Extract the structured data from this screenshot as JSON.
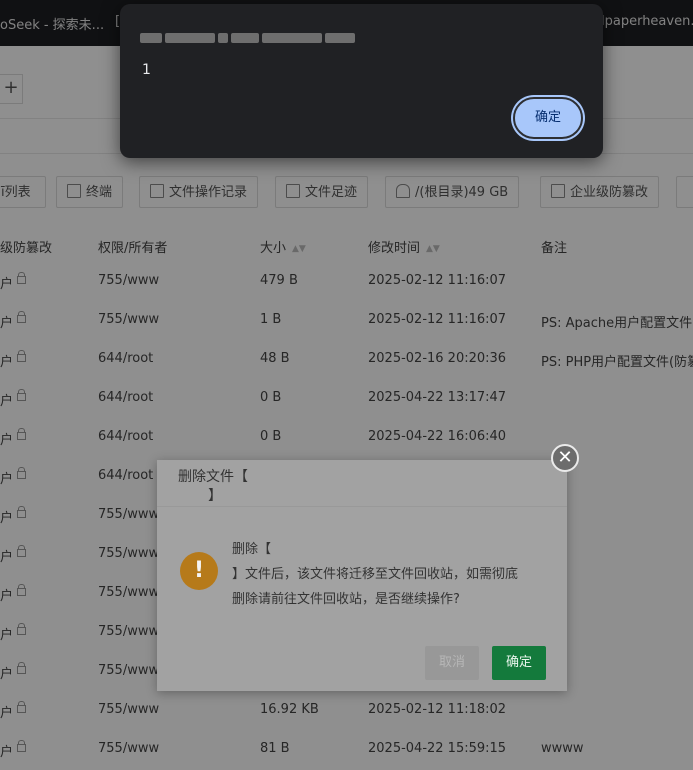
{
  "browser": {
    "tabs": [
      {
        "label": "oSeek - 探索未..."
      },
      {
        "label": "["
      },
      {
        "label": "lpaperheaven."
      }
    ]
  },
  "toolbar": {
    "buttons": [
      {
        "label": "ī列表"
      },
      {
        "label": "终端"
      },
      {
        "label": "文件操作记录"
      },
      {
        "label": "文件足迹"
      },
      {
        "label": "/(根目录)49 GB"
      },
      {
        "label": "企业级防篡改"
      }
    ]
  },
  "table": {
    "headers": [
      "级防篡改",
      "权限/所有者",
      "大小",
      "修改时间",
      "备注"
    ],
    "rows": [
      {
        "prot": "户",
        "perm": "755/www",
        "size": "479 B",
        "time": "2025-02-12 11:16:07",
        "note": ""
      },
      {
        "prot": "户",
        "perm": "755/www",
        "size": "1 B",
        "time": "2025-02-12 11:16:07",
        "note": "PS: Apache用户配置文件("
      },
      {
        "prot": "户",
        "perm": "644/root",
        "size": "48 B",
        "time": "2025-02-16 20:20:36",
        "note": "PS: PHP用户配置文件(防篡"
      },
      {
        "prot": "户",
        "perm": "644/root",
        "size": "0 B",
        "time": "2025-04-22 13:17:47",
        "note": ""
      },
      {
        "prot": "户",
        "perm": "644/root",
        "size": "0 B",
        "time": "2025-04-22 16:06:40",
        "note": ""
      },
      {
        "prot": "户",
        "perm": "644/root",
        "size": "",
        "time": "",
        "note": ""
      },
      {
        "prot": "户",
        "perm": "755/www",
        "size": "",
        "time": "",
        "note": ""
      },
      {
        "prot": "户",
        "perm": "755/www",
        "size": "",
        "time": "",
        "note": ""
      },
      {
        "prot": "户",
        "perm": "755/www",
        "size": "",
        "time": "",
        "note": ""
      },
      {
        "prot": "户",
        "perm": "755/www",
        "size": "",
        "time": "",
        "note": ""
      },
      {
        "prot": "户",
        "perm": "755/www",
        "size": "",
        "time": "",
        "note": ""
      },
      {
        "prot": "户",
        "perm": "755/www",
        "size": "16.92 KB",
        "time": "2025-02-12 11:18:02",
        "note": ""
      },
      {
        "prot": "户",
        "perm": "755/www",
        "size": "81 B",
        "time": "2025-04-22 15:59:15",
        "note": "wwww"
      }
    ]
  },
  "alert": {
    "message": "1",
    "ok_label": "确定"
  },
  "dialog": {
    "title_line1": "删除文件【",
    "title_line2": "】",
    "text_line1": "删除【",
    "text_line2": "】文件后，该文件将迁移至文件回收站，如需彻底",
    "text_line3": "删除请前往文件回收站，是否继续操作?",
    "cancel_label": "取消",
    "ok_label": "确定",
    "close_icon": "close-icon",
    "warning_icon": "warning-icon"
  },
  "colors": {
    "alert_bg": "#202124",
    "alert_button": "#a8c7fa",
    "confirm_green": "#20a53a"
  }
}
